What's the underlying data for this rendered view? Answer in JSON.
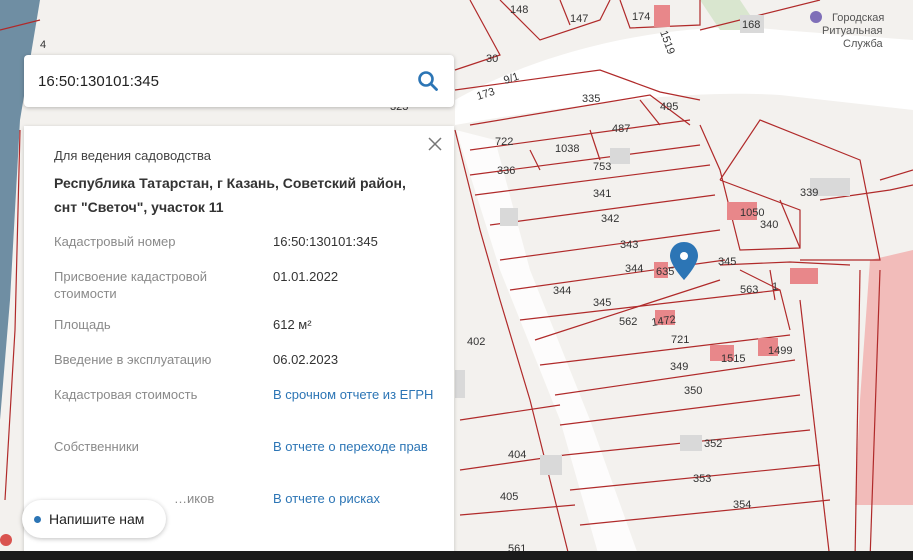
{
  "search": {
    "value": "16:50:130101:345"
  },
  "panel": {
    "purpose": "Для ведения садоводства",
    "address": "Республика Татарстан, г Казань, Советский район, снт \"Светоч\", участок 11",
    "rows": {
      "cadastral_number": {
        "label": "Кадастровый номер",
        "value": "16:50:130101:345"
      },
      "assessment_date": {
        "label": "Присвоение кадастровой стоимости",
        "value": "01.01.2022"
      },
      "area": {
        "label": "Площадь",
        "value": "612 м²"
      },
      "commissioning": {
        "label": "Введение в эксплуатацию",
        "value": "06.02.2023"
      },
      "cadastral_value": {
        "label": "Кадастровая стоимость",
        "value": "В срочном отчете из ЕГРН"
      },
      "owners": {
        "label": "Собственники",
        "value": "В отчете о переходе прав"
      },
      "risks": {
        "label": "…иков",
        "value": "В отчете о рисках"
      }
    }
  },
  "chat": {
    "label": "Напишите нам"
  },
  "map": {
    "poi": [
      "Городская",
      "Ритуальная",
      "Служба"
    ],
    "plot_numbers": [
      "148",
      "147",
      "174",
      "1519",
      "168",
      "30",
      "173",
      "9/1",
      "335",
      "495",
      "4",
      "323",
      "722",
      "487",
      "1038",
      "336",
      "753",
      "339",
      "341",
      "1050",
      "340",
      "342",
      "343",
      "344",
      "635",
      "345",
      "344",
      "345",
      "563",
      "562",
      "1472",
      "721",
      "349",
      "1515",
      "1499",
      "402",
      "350",
      "404",
      "352",
      "405",
      "353",
      "354",
      "561",
      "1"
    ],
    "colors": {
      "background": "#f3f1ee",
      "boundary": "#b02a2a",
      "building": "#e8878a",
      "highlight_zone": "#f2aaa8",
      "road": "#ffffff",
      "water": "#6f8ea3",
      "pin": "#2c75b5"
    }
  }
}
